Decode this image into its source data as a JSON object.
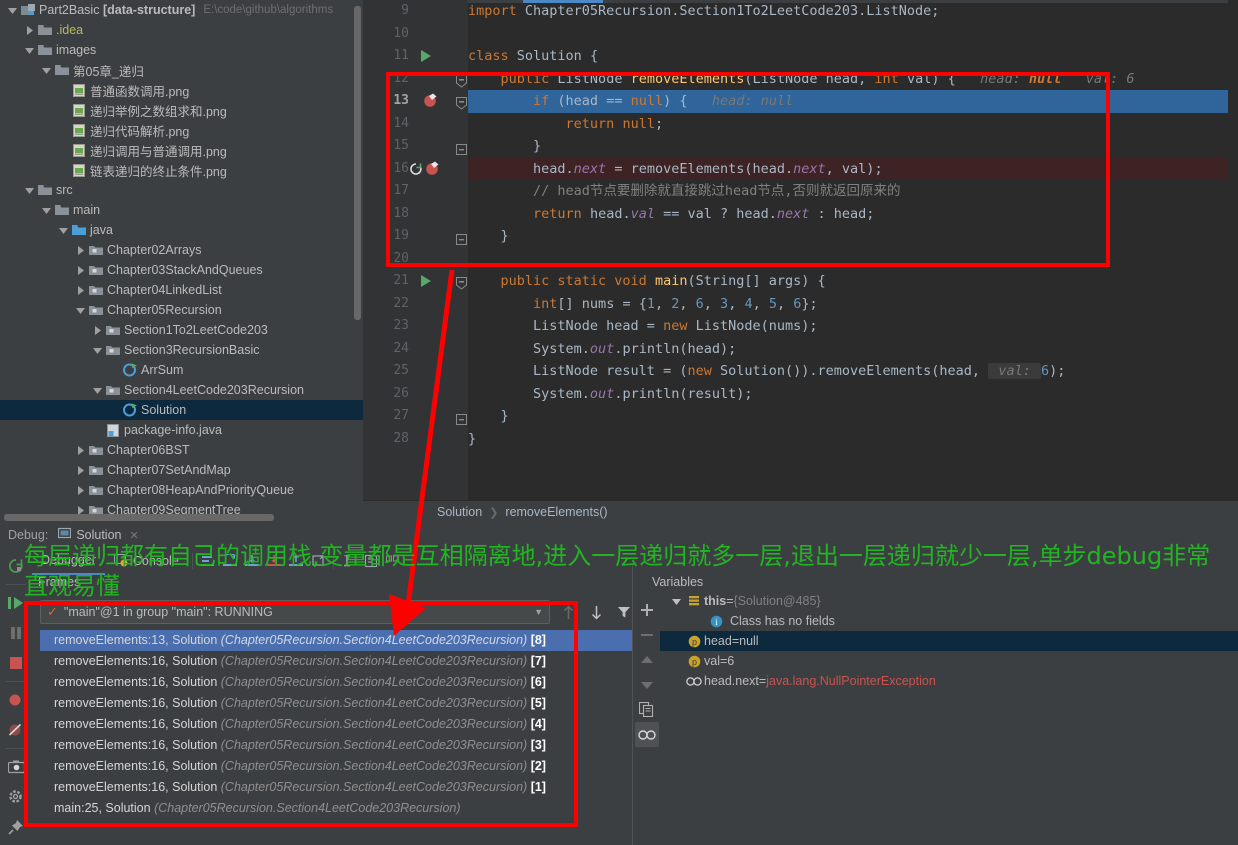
{
  "project": {
    "root": {
      "name": "Part2Basic",
      "module": "[data-structure]",
      "path": "E:\\code\\github\\algorithms"
    },
    "items": [
      {
        "label": ".idea",
        "indent": 1,
        "arrow": "right",
        "icon": "folder-yellow",
        "type": "folder"
      },
      {
        "label": "images",
        "indent": 1,
        "arrow": "down",
        "icon": "folder",
        "type": "folder"
      },
      {
        "label": "第05章_递归",
        "indent": 2,
        "arrow": "down",
        "icon": "folder",
        "type": "folder"
      },
      {
        "label": "普通函数调用.png",
        "indent": 3,
        "arrow": "none",
        "icon": "image-file",
        "type": "file"
      },
      {
        "label": "递归举例之数组求和.png",
        "indent": 3,
        "arrow": "none",
        "icon": "image-file",
        "type": "file"
      },
      {
        "label": "递归代码解析.png",
        "indent": 3,
        "arrow": "none",
        "icon": "image-file",
        "type": "file"
      },
      {
        "label": "递归调用与普通调用.png",
        "indent": 3,
        "arrow": "none",
        "icon": "image-file",
        "type": "file"
      },
      {
        "label": "链表递归的终止条件.png",
        "indent": 3,
        "arrow": "none",
        "icon": "image-file",
        "type": "file"
      },
      {
        "label": "src",
        "indent": 1,
        "arrow": "down",
        "icon": "folder",
        "type": "folder"
      },
      {
        "label": "main",
        "indent": 2,
        "arrow": "down",
        "icon": "folder",
        "type": "folder"
      },
      {
        "label": "java",
        "indent": 3,
        "arrow": "down",
        "icon": "folder-source",
        "type": "folder"
      },
      {
        "label": "Chapter02Arrays",
        "indent": 4,
        "arrow": "right",
        "icon": "package",
        "type": "package"
      },
      {
        "label": "Chapter03StackAndQueues",
        "indent": 4,
        "arrow": "right",
        "icon": "package",
        "type": "package"
      },
      {
        "label": "Chapter04LinkedList",
        "indent": 4,
        "arrow": "right",
        "icon": "package",
        "type": "package"
      },
      {
        "label": "Chapter05Recursion",
        "indent": 4,
        "arrow": "down",
        "icon": "package",
        "type": "package"
      },
      {
        "label": "Section1To2LeetCode203",
        "indent": 5,
        "arrow": "right",
        "icon": "package",
        "type": "package"
      },
      {
        "label": "Section3RecursionBasic",
        "indent": 5,
        "arrow": "down",
        "icon": "package",
        "type": "package"
      },
      {
        "label": "ArrSum",
        "indent": 6,
        "arrow": "none",
        "icon": "java-class-run",
        "type": "class"
      },
      {
        "label": "Section4LeetCode203Recursion",
        "indent": 5,
        "arrow": "down",
        "icon": "package",
        "type": "package"
      },
      {
        "label": "Solution",
        "indent": 6,
        "arrow": "none",
        "icon": "java-class-run",
        "type": "class",
        "selected": true
      },
      {
        "label": "package-info.java",
        "indent": 5,
        "arrow": "none",
        "icon": "java-file",
        "type": "file"
      },
      {
        "label": "Chapter06BST",
        "indent": 4,
        "arrow": "right",
        "icon": "package",
        "type": "package"
      },
      {
        "label": "Chapter07SetAndMap",
        "indent": 4,
        "arrow": "right",
        "icon": "package",
        "type": "package"
      },
      {
        "label": "Chapter08HeapAndPriorityQueue",
        "indent": 4,
        "arrow": "right",
        "icon": "package",
        "type": "package"
      },
      {
        "label": "Chapter09SegmentTree",
        "indent": 4,
        "arrow": "right",
        "icon": "package",
        "type": "package"
      }
    ]
  },
  "editor": {
    "breadcrumb": [
      "Solution",
      "removeElements()"
    ],
    "lines": [
      {
        "num": 9,
        "gutter": "",
        "fold": "",
        "highlight": "",
        "tokens": [
          {
            "t": "import ",
            "c": "kw"
          },
          {
            "t": "Chapter05Recursion.Section1To2LeetCode203.ListNode;",
            "c": "txt"
          }
        ]
      },
      {
        "num": 10,
        "gutter": "",
        "fold": "",
        "highlight": "",
        "tokens": []
      },
      {
        "num": 11,
        "gutter": "run",
        "fold": "",
        "highlight": "",
        "tokens": [
          {
            "t": "class ",
            "c": "kw"
          },
          {
            "t": "Solution ",
            "c": "typ"
          },
          {
            "t": "{",
            "c": "txt"
          }
        ]
      },
      {
        "num": 12,
        "gutter": "",
        "fold": "minus",
        "highlight": "",
        "tokens": [
          {
            "t": "    ",
            "c": "txt"
          },
          {
            "t": "public ",
            "c": "kw"
          },
          {
            "t": "ListNode ",
            "c": "typ"
          },
          {
            "t": "removeElements",
            "c": "fn"
          },
          {
            "t": "(ListNode head, ",
            "c": "txt"
          },
          {
            "t": "int ",
            "c": "kw"
          },
          {
            "t": "val) {",
            "c": "txt"
          },
          {
            "t": "   head: ",
            "c": "hint"
          },
          {
            "t": "null",
            "c": "hint-b"
          },
          {
            "t": "   val: 6",
            "c": "hint"
          }
        ]
      },
      {
        "num": 13,
        "gutter": "breakpoint-check",
        "fold": "minus",
        "highlight": "blue",
        "current": true,
        "tokens": [
          {
            "t": "        ",
            "c": "txt"
          },
          {
            "t": "if ",
            "c": "kw"
          },
          {
            "t": "(head == ",
            "c": "txt"
          },
          {
            "t": "null",
            "c": "kw"
          },
          {
            "t": ") {",
            "c": "txt"
          },
          {
            "t": "   head: null",
            "c": "hint"
          }
        ]
      },
      {
        "num": 14,
        "gutter": "",
        "fold": "",
        "highlight": "",
        "tokens": [
          {
            "t": "            ",
            "c": "txt"
          },
          {
            "t": "return null",
            "c": "kw"
          },
          {
            "t": ";",
            "c": "txt"
          }
        ]
      },
      {
        "num": 15,
        "gutter": "",
        "fold": "end",
        "highlight": "",
        "tokens": [
          {
            "t": "        }",
            "c": "txt"
          }
        ]
      },
      {
        "num": 16,
        "gutter": "rerun-breakpoint",
        "fold": "",
        "highlight": "red",
        "tokens": [
          {
            "t": "        head.",
            "c": "txt"
          },
          {
            "t": "next ",
            "c": "fld"
          },
          {
            "t": "= ",
            "c": "txt"
          },
          {
            "t": "removeElements",
            "c": "txt"
          },
          {
            "t": "(head.",
            "c": "txt"
          },
          {
            "t": "next",
            "c": "fld"
          },
          {
            "t": ", val);",
            "c": "txt"
          }
        ]
      },
      {
        "num": 17,
        "gutter": "",
        "fold": "",
        "highlight": "",
        "tokens": [
          {
            "t": "        // head节点要删除就直接跳过head节点,否则就返回原来的",
            "c": "cmt"
          }
        ]
      },
      {
        "num": 18,
        "gutter": "",
        "fold": "",
        "highlight": "",
        "tokens": [
          {
            "t": "        ",
            "c": "txt"
          },
          {
            "t": "return ",
            "c": "kw"
          },
          {
            "t": "head.",
            "c": "txt"
          },
          {
            "t": "val ",
            "c": "fld"
          },
          {
            "t": "== val ? head.",
            "c": "txt"
          },
          {
            "t": "next ",
            "c": "fld"
          },
          {
            "t": ": head;",
            "c": "txt"
          }
        ]
      },
      {
        "num": 19,
        "gutter": "",
        "fold": "end",
        "highlight": "",
        "tokens": [
          {
            "t": "    }",
            "c": "txt"
          }
        ]
      },
      {
        "num": 20,
        "gutter": "",
        "fold": "",
        "highlight": "",
        "tokens": []
      },
      {
        "num": 21,
        "gutter": "run",
        "fold": "minus",
        "highlight": "",
        "tokens": [
          {
            "t": "    ",
            "c": "txt"
          },
          {
            "t": "public static void ",
            "c": "kw"
          },
          {
            "t": "main",
            "c": "fn"
          },
          {
            "t": "(String[] args) {",
            "c": "txt"
          }
        ]
      },
      {
        "num": 22,
        "gutter": "",
        "fold": "",
        "highlight": "",
        "tokens": [
          {
            "t": "        ",
            "c": "txt"
          },
          {
            "t": "int",
            "c": "kw"
          },
          {
            "t": "[] nums = {",
            "c": "txt"
          },
          {
            "t": "1",
            "c": "num"
          },
          {
            "t": ", ",
            "c": "txt"
          },
          {
            "t": "2",
            "c": "num"
          },
          {
            "t": ", ",
            "c": "txt"
          },
          {
            "t": "6",
            "c": "num"
          },
          {
            "t": ", ",
            "c": "txt"
          },
          {
            "t": "3",
            "c": "num"
          },
          {
            "t": ", ",
            "c": "txt"
          },
          {
            "t": "4",
            "c": "num"
          },
          {
            "t": ", ",
            "c": "txt"
          },
          {
            "t": "5",
            "c": "num"
          },
          {
            "t": ", ",
            "c": "txt"
          },
          {
            "t": "6",
            "c": "num"
          },
          {
            "t": "};",
            "c": "txt"
          }
        ]
      },
      {
        "num": 23,
        "gutter": "",
        "fold": "",
        "highlight": "",
        "tokens": [
          {
            "t": "        ListNode head = ",
            "c": "txt"
          },
          {
            "t": "new ",
            "c": "kw"
          },
          {
            "t": "ListNode(nums);",
            "c": "txt"
          }
        ]
      },
      {
        "num": 24,
        "gutter": "",
        "fold": "",
        "highlight": "",
        "tokens": [
          {
            "t": "        System.",
            "c": "txt"
          },
          {
            "t": "out",
            "c": "fld"
          },
          {
            "t": ".println(head);",
            "c": "txt"
          }
        ]
      },
      {
        "num": 25,
        "gutter": "",
        "fold": "",
        "highlight": "",
        "tokens": [
          {
            "t": "        ListNode result = (",
            "c": "txt"
          },
          {
            "t": "new ",
            "c": "kw"
          },
          {
            "t": "Solution()).removeElements(head, ",
            "c": "txt"
          },
          {
            "t": " val: ",
            "c": "hintbox"
          },
          {
            "t": "6",
            "c": "num"
          },
          {
            "t": ");",
            "c": "txt"
          }
        ]
      },
      {
        "num": 26,
        "gutter": "",
        "fold": "",
        "highlight": "",
        "tokens": [
          {
            "t": "        System.",
            "c": "txt"
          },
          {
            "t": "out",
            "c": "fld"
          },
          {
            "t": ".println(result);",
            "c": "txt"
          }
        ]
      },
      {
        "num": 27,
        "gutter": "",
        "fold": "end",
        "highlight": "",
        "tokens": [
          {
            "t": "    }",
            "c": "txt"
          }
        ]
      },
      {
        "num": 28,
        "gutter": "",
        "fold": "",
        "highlight": "",
        "tokens": [
          {
            "t": "}",
            "c": "txt"
          }
        ]
      }
    ]
  },
  "debug": {
    "label": "Debug:",
    "config_name": "Solution",
    "tabs": [
      {
        "label": "Debugger",
        "active": true
      },
      {
        "label": "Console",
        "active": false
      }
    ],
    "frames_label": "Frames",
    "variables_label": "Variables",
    "thread": "\"main\"@1 in group \"main\": RUNNING",
    "frames": [
      {
        "method": "removeElements:13, Solution",
        "pkg": "(Chapter05Recursion.Section4LeetCode203Recursion)",
        "idx": "[8]",
        "selected": true
      },
      {
        "method": "removeElements:16, Solution",
        "pkg": "(Chapter05Recursion.Section4LeetCode203Recursion)",
        "idx": "[7]"
      },
      {
        "method": "removeElements:16, Solution",
        "pkg": "(Chapter05Recursion.Section4LeetCode203Recursion)",
        "idx": "[6]"
      },
      {
        "method": "removeElements:16, Solution",
        "pkg": "(Chapter05Recursion.Section4LeetCode203Recursion)",
        "idx": "[5]"
      },
      {
        "method": "removeElements:16, Solution",
        "pkg": "(Chapter05Recursion.Section4LeetCode203Recursion)",
        "idx": "[4]"
      },
      {
        "method": "removeElements:16, Solution",
        "pkg": "(Chapter05Recursion.Section4LeetCode203Recursion)",
        "idx": "[3]"
      },
      {
        "method": "removeElements:16, Solution",
        "pkg": "(Chapter05Recursion.Section4LeetCode203Recursion)",
        "idx": "[2]"
      },
      {
        "method": "removeElements:16, Solution",
        "pkg": "(Chapter05Recursion.Section4LeetCode203Recursion)",
        "idx": "[1]"
      },
      {
        "method": "main:25, Solution",
        "pkg": "(Chapter05Recursion.Section4LeetCode203Recursion)",
        "idx": ""
      }
    ],
    "variables": [
      {
        "icon": "object-icon",
        "tri": "down",
        "indent": 0,
        "name": "this",
        "eq": " = ",
        "value": "{Solution@485}",
        "value_class": "dim"
      },
      {
        "icon": "info-icon",
        "tri": "none",
        "indent": 1,
        "name": "",
        "eq": "",
        "value": "Class has no fields",
        "value_class": "plain"
      },
      {
        "icon": "param-icon",
        "tri": "none",
        "indent": 0,
        "name": "head",
        "eq": " = ",
        "value": "null",
        "value_class": "plain",
        "selected": true
      },
      {
        "icon": "param-icon",
        "tri": "none",
        "indent": 0,
        "name": "val",
        "eq": " = ",
        "value": "6",
        "value_class": "plain"
      },
      {
        "icon": "watch-icon",
        "tri": "none",
        "indent": 0,
        "name": "head.next",
        "eq": " = ",
        "value": "java.lang.NullPointerException",
        "value_class": "err"
      }
    ]
  },
  "annotation": {
    "green_note": "每层递归都有自己的调用栈,变量都是互相隔离地,进入一层递归就多一层,退出一层递归就少一层,单步debug非常直观易懂",
    "highlight_color": "#ff0000",
    "note_color": "#22b522"
  }
}
